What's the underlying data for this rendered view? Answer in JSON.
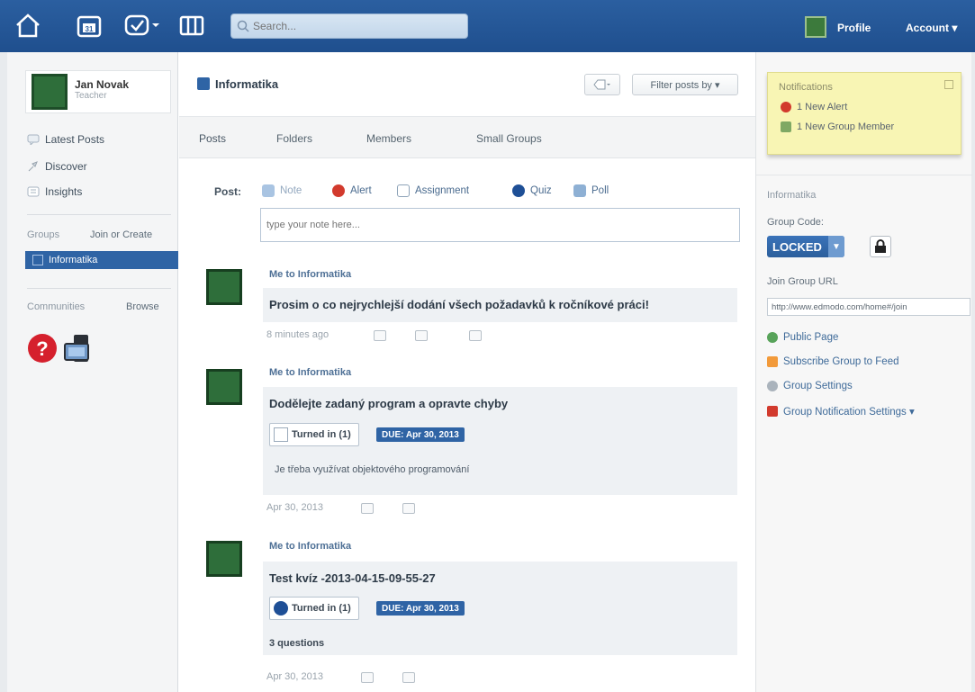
{
  "topbar": {
    "search_placeholder": "Search...",
    "calendar_day": "31",
    "profile_label": "Profile",
    "account_label": "Account ▾"
  },
  "sidebar": {
    "user_name": "Jan Novak",
    "user_role": "Teacher",
    "nav": [
      "Latest Posts",
      "Discover",
      "Insights"
    ],
    "groups_label": "Groups",
    "join_create": "Join or Create",
    "selected_group": "Informatika",
    "communities_label": "Communities",
    "browse": "Browse"
  },
  "group_header": {
    "name": "Informatika",
    "filter_label": "Filter posts by ▾"
  },
  "tabs": [
    "Posts",
    "Folders",
    "Members",
    "Small Groups"
  ],
  "composer": {
    "label": "Post:",
    "types": [
      "Note",
      "Alert",
      "Assignment",
      "Quiz",
      "Poll"
    ],
    "placeholder": "type your note here..."
  },
  "posts": [
    {
      "meta": "Me to Informatika",
      "text": "Prosim o co nejrychlejší dodání všech požadavků k ročníkové práci!",
      "time": "8 minutes ago"
    },
    {
      "meta": "Me to Informatika",
      "text": "Dodělejte zadaný program a opravte chyby",
      "turned_in": "Turned in (1)",
      "due": "DUE: Apr 30, 2013",
      "sub": "Je třeba využívat objektového programování",
      "time": "Apr 30, 2013"
    },
    {
      "meta": "Me to Informatika",
      "text": "Test kvíz -2013-04-15-09-55-27",
      "turned_in": "Turned in (1)",
      "due": "DUE: Apr 30, 2013",
      "sub": "3 questions",
      "time": "Apr 30, 2013"
    }
  ],
  "notifications": {
    "title": "Notifications",
    "items": [
      "1 New Alert",
      "1 New Group Member"
    ]
  },
  "right": {
    "group_name": "Informatika",
    "group_code_label": "Group Code:",
    "locked_label": "LOCKED",
    "join_url_label": "Join Group URL",
    "join_url": "http://www.edmodo.com/home#/join",
    "links": [
      "Public Page",
      "Subscribe Group to Feed",
      "Group Settings",
      "Group Notification Settings ▾"
    ]
  },
  "colors": {
    "topbar": "#2b5fa0",
    "accent_blue": "#2f64a5",
    "notification_bg": "#f8f5b4"
  }
}
